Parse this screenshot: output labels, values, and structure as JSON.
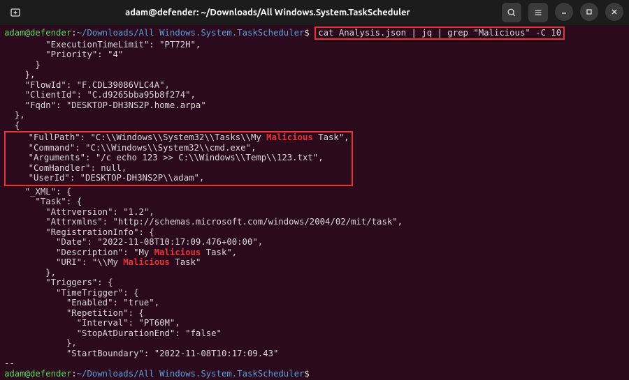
{
  "titlebar": {
    "title": "adam@defender: ~/Downloads/All Windows.System.TaskScheduler"
  },
  "prompt": {
    "user": "adam@defender",
    "sep": ":",
    "path": "~/Downloads/All Windows.System.TaskScheduler",
    "dollar": "$"
  },
  "command": "cat Analysis.json | jq | grep \"Malicious\" -C 10",
  "grep_word": "Malicious",
  "output": {
    "pre_box": [
      "        \"ExecutionTimeLimit\": \"PT72H\",",
      "        \"Priority\": \"4\"",
      "      }",
      "    },",
      "    \"FlowId\": \"F.CDL39086VLC4A\",",
      "    \"ClientId\": \"C.d9265bba95b8f274\",",
      "    \"Fqdn\": \"DESKTOP-DH3NS2P.home.arpa\"",
      "  },",
      "  {"
    ],
    "box": [
      {
        "prefix": "    \"FullPath\": \"C:\\\\Windows\\\\System32\\\\Tasks\\\\My ",
        "match": "Malicious",
        "suffix": " Task\","
      },
      {
        "prefix": "    \"Command\": \"C:\\\\Windows\\\\System32\\\\cmd.exe\",",
        "match": "",
        "suffix": ""
      },
      {
        "prefix": "    \"Arguments\": \"/c echo 123 >> C:\\\\Windows\\\\Temp\\\\123.txt\",",
        "match": "",
        "suffix": ""
      },
      {
        "prefix": "    \"ComHandler\": null,",
        "match": "",
        "suffix": ""
      },
      {
        "prefix": "    \"UserId\": \"DESKTOP-DH3NS2P\\\\adam\",",
        "match": "",
        "suffix": ""
      }
    ],
    "post_box": [
      {
        "prefix": "    \"_XML\": {",
        "match": "",
        "suffix": ""
      },
      {
        "prefix": "      \"Task\": {",
        "match": "",
        "suffix": ""
      },
      {
        "prefix": "        \"Attrversion\": \"1.2\",",
        "match": "",
        "suffix": ""
      },
      {
        "prefix": "        \"Attrxmlns\": \"http://schemas.microsoft.com/windows/2004/02/mit/task\",",
        "match": "",
        "suffix": ""
      },
      {
        "prefix": "        \"RegistrationInfo\": {",
        "match": "",
        "suffix": ""
      },
      {
        "prefix": "          \"Date\": \"2022-11-08T10:17:09.476+00:00\",",
        "match": "",
        "suffix": ""
      },
      {
        "prefix": "          \"Description\": \"My ",
        "match": "Malicious",
        "suffix": " Task\","
      },
      {
        "prefix": "          \"URI\": \"\\\\My ",
        "match": "Malicious",
        "suffix": " Task\""
      },
      {
        "prefix": "        },",
        "match": "",
        "suffix": ""
      },
      {
        "prefix": "        \"Triggers\": {",
        "match": "",
        "suffix": ""
      },
      {
        "prefix": "          \"TimeTrigger\": {",
        "match": "",
        "suffix": ""
      },
      {
        "prefix": "            \"Enabled\": \"true\",",
        "match": "",
        "suffix": ""
      },
      {
        "prefix": "            \"Repetition\": {",
        "match": "",
        "suffix": ""
      },
      {
        "prefix": "              \"Interval\": \"PT60M\",",
        "match": "",
        "suffix": ""
      },
      {
        "prefix": "              \"StopAtDurationEnd\": \"false\"",
        "match": "",
        "suffix": ""
      },
      {
        "prefix": "            },",
        "match": "",
        "suffix": ""
      },
      {
        "prefix": "            \"StartBoundary\": \"2022-11-08T10:17:09.43\"",
        "match": "",
        "suffix": ""
      },
      {
        "prefix": "--",
        "match": "",
        "suffix": ""
      }
    ]
  }
}
